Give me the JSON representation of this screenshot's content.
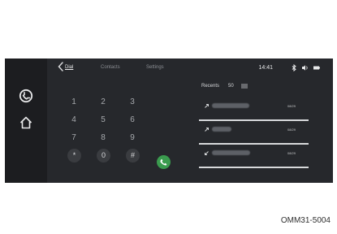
{
  "topbar": {
    "tabs": [
      {
        "label": "Dial"
      },
      {
        "label": "Contacts"
      },
      {
        "label": "Settings"
      }
    ],
    "time": "14:41",
    "status_icons": [
      "bluetooth-icon",
      "volume-icon",
      "battery-icon"
    ]
  },
  "leftbar": {
    "icons": [
      "phone-icon",
      "home-icon"
    ]
  },
  "dialpad": {
    "keys": [
      "1",
      "2",
      "3",
      "4",
      "5",
      "6",
      "7",
      "8",
      "9",
      "*",
      "0",
      "#"
    ]
  },
  "recents": {
    "title": "Recents",
    "count": "50",
    "items": [
      {
        "direction": "outgoing",
        "date": "08/29"
      },
      {
        "direction": "outgoing",
        "date": "08/29"
      },
      {
        "direction": "incoming",
        "date": "08/29"
      }
    ]
  },
  "caption": "OMM31-5004"
}
